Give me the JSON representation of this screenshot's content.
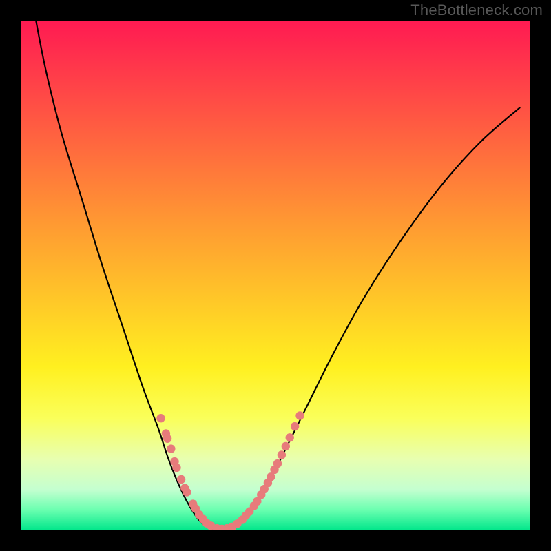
{
  "watermark": "TheBottleneck.com",
  "colors": {
    "curve_stroke": "#000000",
    "marker_fill": "#e77b7b",
    "marker_stroke": "#c85f5f"
  },
  "chart_data": {
    "type": "line",
    "title": "",
    "xlabel": "",
    "ylabel": "",
    "xlim": [
      0,
      100
    ],
    "ylim": [
      0,
      100
    ],
    "grid": false,
    "series": [
      {
        "name": "bottleneck-curve",
        "x": [
          3,
          5,
          8,
          12,
          16,
          20,
          24,
          27,
          29,
          31,
          33,
          35,
          37,
          39,
          41,
          43,
          46,
          49,
          52,
          56,
          61,
          67,
          74,
          82,
          90,
          98
        ],
        "y": [
          100,
          90,
          78,
          65,
          52,
          40,
          28,
          20,
          14,
          9,
          5,
          2,
          0.5,
          0,
          0.5,
          2,
          5,
          10,
          16,
          24,
          34,
          45,
          56,
          67,
          76,
          83
        ]
      }
    ],
    "markers": [
      {
        "name": "left-cluster",
        "points": [
          {
            "x": 27.5,
            "y": 22
          },
          {
            "x": 28.5,
            "y": 19
          },
          {
            "x": 28.8,
            "y": 18
          },
          {
            "x": 29.5,
            "y": 16
          },
          {
            "x": 30.2,
            "y": 13.5
          },
          {
            "x": 30.6,
            "y": 12.3
          },
          {
            "x": 31.5,
            "y": 10
          },
          {
            "x": 32.2,
            "y": 8.3
          },
          {
            "x": 32.6,
            "y": 7.5
          },
          {
            "x": 33.8,
            "y": 5.2
          },
          {
            "x": 34.3,
            "y": 4.3
          },
          {
            "x": 35.0,
            "y": 3.1
          }
        ]
      },
      {
        "name": "bottom-cluster",
        "points": [
          {
            "x": 35.8,
            "y": 2.2
          },
          {
            "x": 36.5,
            "y": 1.4
          },
          {
            "x": 37.3,
            "y": 0.9
          },
          {
            "x": 38.5,
            "y": 0.4
          },
          {
            "x": 39.5,
            "y": 0.3
          },
          {
            "x": 40.5,
            "y": 0.4
          },
          {
            "x": 41.5,
            "y": 0.7
          },
          {
            "x": 42.5,
            "y": 1.3
          },
          {
            "x": 43.5,
            "y": 2.1
          },
          {
            "x": 44.2,
            "y": 2.9
          },
          {
            "x": 44.9,
            "y": 3.7
          }
        ]
      },
      {
        "name": "right-cluster",
        "points": [
          {
            "x": 45.8,
            "y": 4.8
          },
          {
            "x": 46.4,
            "y": 5.7
          },
          {
            "x": 47.2,
            "y": 7.0
          },
          {
            "x": 47.8,
            "y": 8.1
          },
          {
            "x": 48.5,
            "y": 9.3
          },
          {
            "x": 49.1,
            "y": 10.5
          },
          {
            "x": 49.8,
            "y": 11.9
          },
          {
            "x": 50.4,
            "y": 13.1
          },
          {
            "x": 51.2,
            "y": 14.8
          },
          {
            "x": 52.0,
            "y": 16.5
          },
          {
            "x": 52.8,
            "y": 18.2
          },
          {
            "x": 53.8,
            "y": 20.4
          },
          {
            "x": 54.8,
            "y": 22.5
          }
        ]
      }
    ]
  }
}
